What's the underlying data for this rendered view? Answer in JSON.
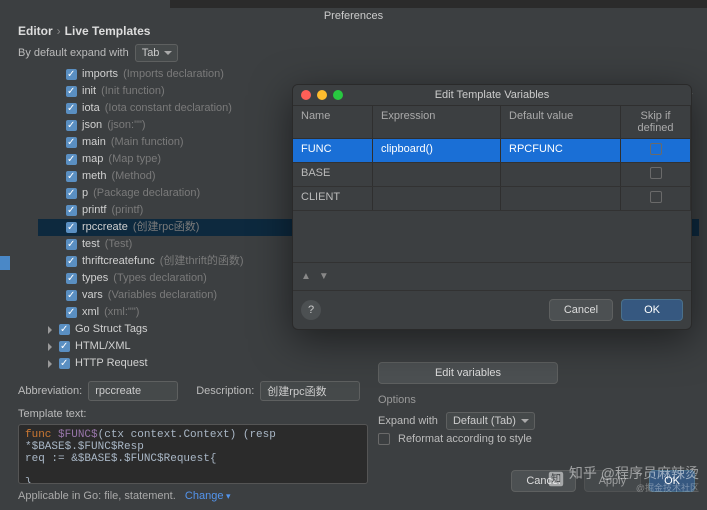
{
  "window": {
    "title": "Preferences"
  },
  "breadcrumb": {
    "a": "Editor",
    "b": "Live Templates"
  },
  "expand_row": {
    "label": "By default expand with",
    "value": "Tab"
  },
  "tree": [
    {
      "lvl": 2,
      "name": "imports",
      "desc": "(Imports declaration)"
    },
    {
      "lvl": 2,
      "name": "init",
      "desc": "(Init function)"
    },
    {
      "lvl": 2,
      "name": "iota",
      "desc": "(Iota constant declaration)"
    },
    {
      "lvl": 2,
      "name": "json",
      "desc": "(json:\"\")"
    },
    {
      "lvl": 2,
      "name": "main",
      "desc": "(Main function)"
    },
    {
      "lvl": 2,
      "name": "map",
      "desc": "(Map type)"
    },
    {
      "lvl": 2,
      "name": "meth",
      "desc": "(Method)"
    },
    {
      "lvl": 2,
      "name": "p",
      "desc": "(Package declaration)"
    },
    {
      "lvl": 2,
      "name": "printf",
      "desc": "(printf)"
    },
    {
      "lvl": 2,
      "name": "rpccreate",
      "desc": "(创建rpc函数)",
      "selected": true
    },
    {
      "lvl": 2,
      "name": "test",
      "desc": "(Test)"
    },
    {
      "lvl": 2,
      "name": "thriftcreatefunc",
      "desc": "(创建thrift的函数)"
    },
    {
      "lvl": 2,
      "name": "types",
      "desc": "(Types declaration)"
    },
    {
      "lvl": 2,
      "name": "vars",
      "desc": "(Variables declaration)"
    },
    {
      "lvl": 2,
      "name": "xml",
      "desc": "(xml:\"\")"
    },
    {
      "lvl": 1,
      "name": "Go Struct Tags",
      "desc": "",
      "caret": true
    },
    {
      "lvl": 1,
      "name": "HTML/XML",
      "desc": "",
      "caret": true
    },
    {
      "lvl": 1,
      "name": "HTTP Request",
      "desc": "",
      "caret": true
    }
  ],
  "form": {
    "abbr_label": "Abbreviation:",
    "abbr_value": "rpccreate",
    "desc_label": "Description:",
    "desc_value": "创建rpc函数",
    "tmpl_label": "Template text:",
    "code_line1_kw": "func ",
    "code_line1_var": "$FUNC$",
    "code_line1_rest": "(ctx context.Context) (resp *$BASE$.$FUNC$Resp",
    "code_line2": "    req := &$BASE$.$FUNC$Request{",
    "code_line3": "    }",
    "code_line4": "",
    "applicable_text": "Applicable in Go: file, statement.",
    "applicable_link": "Change"
  },
  "options": {
    "edit_variables_btn": "Edit variables",
    "header": "Options",
    "expand_label": "Expand with",
    "expand_value": "Default (Tab)",
    "reformat": "Reformat according to style"
  },
  "footer": {
    "cancel": "Cancel",
    "apply": "Apply",
    "ok": "OK"
  },
  "dialog": {
    "title": "Edit Template Variables",
    "cols": {
      "name": "Name",
      "expr": "Expression",
      "def": "Default value",
      "skip": "Skip if defined"
    },
    "rows": [
      {
        "name": "FUNC",
        "expr": "clipboard()",
        "def": "RPCFUNC",
        "sel": true
      },
      {
        "name": "BASE",
        "expr": "",
        "def": ""
      },
      {
        "name": "CLIENT",
        "expr": "",
        "def": ""
      }
    ],
    "cancel": "Cancel",
    "ok": "OK"
  },
  "watermark": {
    "text": "知乎 @程序员麻辣烫",
    "sub": "@掘金技术社区"
  }
}
